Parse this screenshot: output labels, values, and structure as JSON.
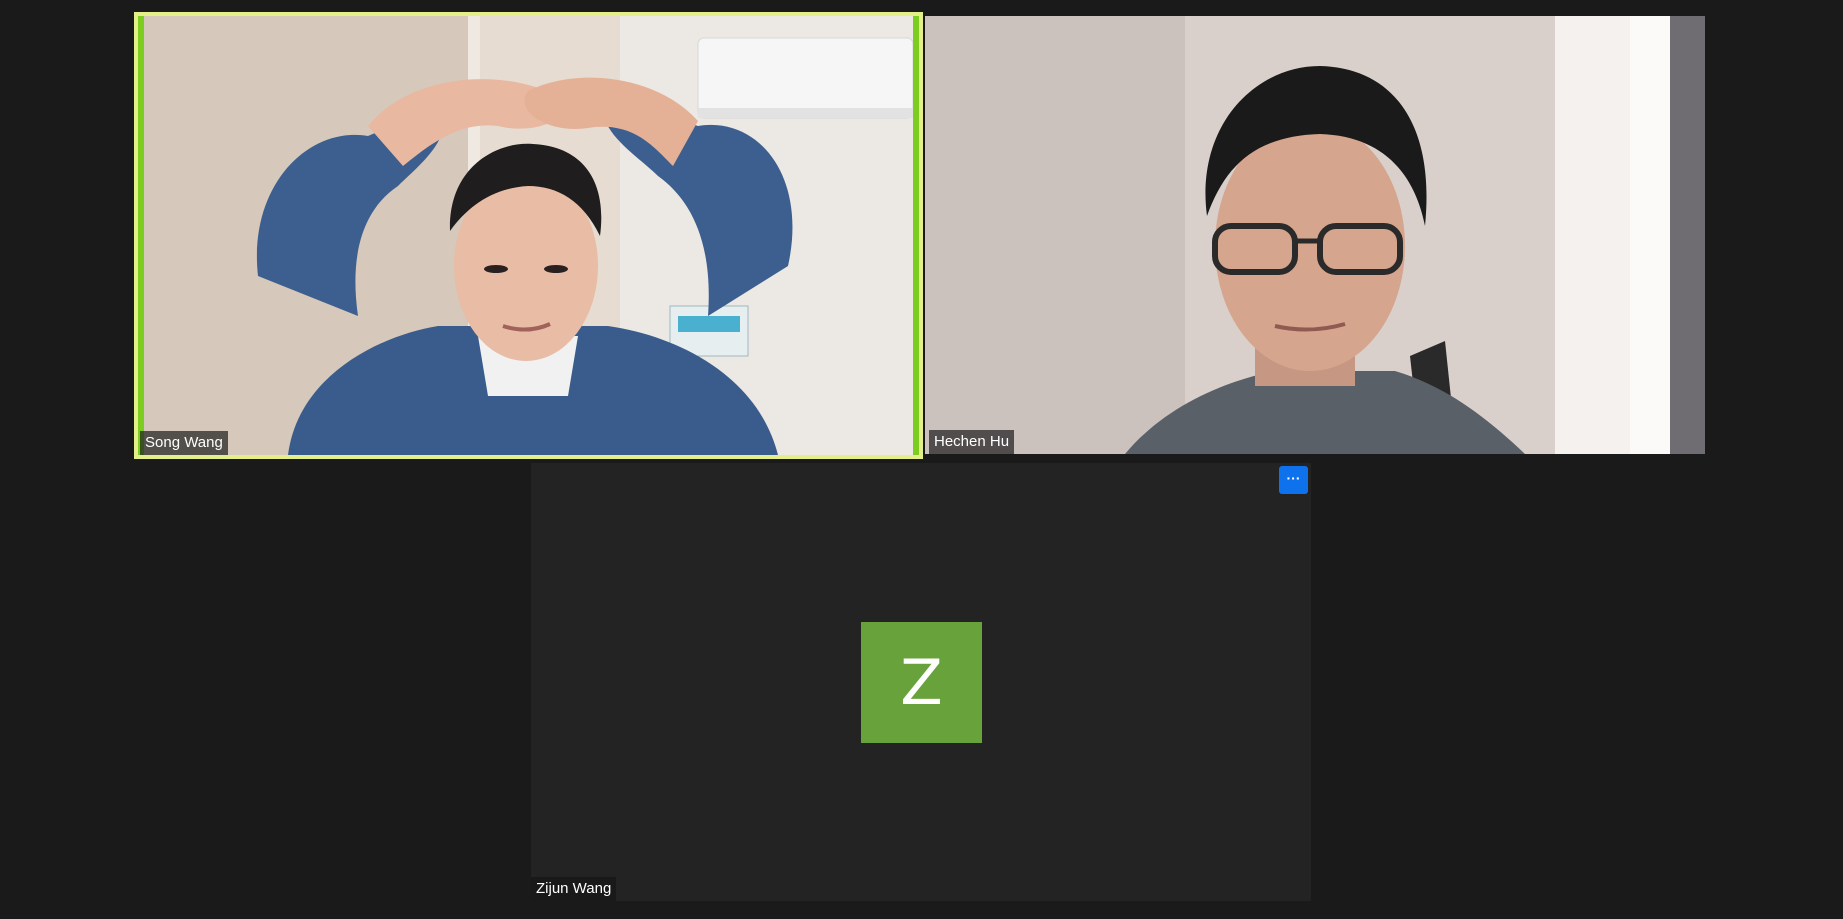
{
  "meeting": {
    "participants": [
      {
        "name": "Song Wang",
        "video": true,
        "active_speaker": true
      },
      {
        "name": "Hechen Hu",
        "video": true,
        "active_speaker": false
      },
      {
        "name": "Zijun Wang",
        "video": false,
        "avatar_letter": "Z",
        "avatar_color": "#68a23a",
        "more_label": "···"
      }
    ]
  },
  "colors": {
    "background": "#1a1a1a",
    "active_speaker_border": "#e4ef8a",
    "more_button": "#0e72ed"
  }
}
